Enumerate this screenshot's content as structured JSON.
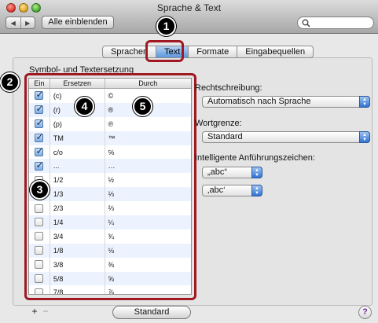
{
  "window": {
    "title": "Sprache & Text"
  },
  "toolbar": {
    "back_glyph": "◀",
    "forward_glyph": "▶",
    "show_all_label": "Alle einblenden",
    "search_placeholder": ""
  },
  "tabs": [
    {
      "label": "Sprachen",
      "active": false
    },
    {
      "label": "Text",
      "active": true
    },
    {
      "label": "Formate",
      "active": false
    },
    {
      "label": "Eingabequellen",
      "active": false
    }
  ],
  "section_label": "Symbol- und Textersetzung",
  "table": {
    "headers": {
      "enabled": "Ein",
      "replace": "Ersetzen",
      "with": "Durch"
    },
    "rows": [
      {
        "enabled": true,
        "replace": "(c)",
        "with": "©"
      },
      {
        "enabled": true,
        "replace": "(r)",
        "with": "®"
      },
      {
        "enabled": true,
        "replace": "(p)",
        "with": "℗"
      },
      {
        "enabled": true,
        "replace": "TM",
        "with": "™"
      },
      {
        "enabled": true,
        "replace": "c/o",
        "with": "℅"
      },
      {
        "enabled": true,
        "replace": "...",
        "with": "…"
      },
      {
        "enabled": false,
        "replace": "1/2",
        "with": "½"
      },
      {
        "enabled": false,
        "replace": "1/3",
        "with": "⅓"
      },
      {
        "enabled": false,
        "replace": "2/3",
        "with": "⅔"
      },
      {
        "enabled": false,
        "replace": "1/4",
        "with": "¼"
      },
      {
        "enabled": false,
        "replace": "3/4",
        "with": "¾"
      },
      {
        "enabled": false,
        "replace": "1/8",
        "with": "⅛"
      },
      {
        "enabled": false,
        "replace": "3/8",
        "with": "⅜"
      },
      {
        "enabled": false,
        "replace": "5/8",
        "with": "⅝"
      },
      {
        "enabled": false,
        "replace": "7/8",
        "with": "⅞"
      }
    ]
  },
  "add_glyph": "+",
  "remove_glyph": "−",
  "standard_button": "Standard",
  "right": {
    "spelling_label": "Rechtschreibung:",
    "spelling_value": "Automatisch nach Sprache",
    "word_break_label": "Wortgrenze:",
    "word_break_value": "Standard",
    "smart_quotes_label": "Intelligente Anführungszeichen:",
    "double_quotes_value": "„abc“",
    "single_quotes_value": "‚abc‘"
  },
  "help_glyph": "?",
  "callouts": [
    "1",
    "2",
    "3",
    "4",
    "5"
  ],
  "colors": {
    "highlight": "#a01922",
    "active_tab": "#5c97dd",
    "popup_arrow": "#2f73d3"
  }
}
